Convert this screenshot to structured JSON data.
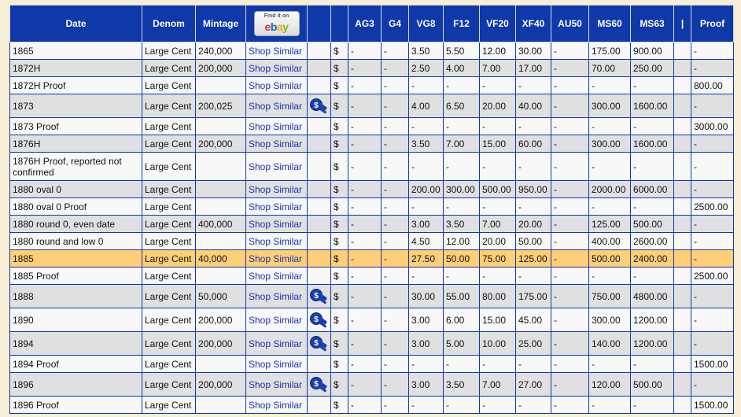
{
  "headers": {
    "date": "Date",
    "denom": "Denom",
    "mintage": "Mintage",
    "ebay_find": "Find it on",
    "ebay_e": "e",
    "ebay_b": "b",
    "ebay_a": "a",
    "ebay_y": "y",
    "ag3": "AG3",
    "g4": "G4",
    "vg8": "VG8",
    "f12": "F12",
    "vf20": "VF20",
    "xf40": "XF40",
    "au50": "AU50",
    "ms60": "MS60",
    "ms63": "MS63",
    "sep": "|",
    "proof": "Proof"
  },
  "colors": {
    "header_bg": "#0f38a9",
    "highlight": "#ffcf78",
    "link": "#1a33b4"
  },
  "rows": [
    {
      "date": "1865",
      "denom": "Large Cent",
      "mintage": "240,000",
      "shop": "Shop Similar",
      "gavel": false,
      "cur": "$",
      "ag3": "-",
      "g4": "-",
      "vg8": "3.50",
      "f12": "5.50",
      "vf20": "12.00",
      "xf40": "30.00",
      "au50": "-",
      "ms60": "175.00",
      "ms63": "900.00",
      "sep": "",
      "proof": "-"
    },
    {
      "date": "1872H",
      "denom": "Large Cent",
      "mintage": "200,000",
      "shop": "Shop Similar",
      "gavel": false,
      "cur": "$",
      "ag3": "-",
      "g4": "-",
      "vg8": "2.50",
      "f12": "4.00",
      "vf20": "7.00",
      "xf40": "17.00",
      "au50": "-",
      "ms60": "70.00",
      "ms63": "250.00",
      "sep": "",
      "proof": "-"
    },
    {
      "date": "1872H Proof",
      "denom": "Large Cent",
      "mintage": "",
      "shop": "Shop Similar",
      "gavel": false,
      "cur": "$",
      "ag3": "-",
      "g4": "-",
      "vg8": "-",
      "f12": "-",
      "vf20": "-",
      "xf40": "-",
      "au50": "-",
      "ms60": "-",
      "ms63": "-",
      "sep": "",
      "proof": "800.00"
    },
    {
      "date": "1873",
      "denom": "Large Cent",
      "mintage": "200,025",
      "shop": "Shop Similar",
      "gavel": true,
      "cur": "$",
      "ag3": "-",
      "g4": "-",
      "vg8": "4.00",
      "f12": "6.50",
      "vf20": "20.00",
      "xf40": "40.00",
      "au50": "-",
      "ms60": "300.00",
      "ms63": "1600.00",
      "sep": "",
      "proof": "-"
    },
    {
      "date": "1873 Proof",
      "denom": "Large Cent",
      "mintage": "",
      "shop": "Shop Similar",
      "gavel": false,
      "cur": "$",
      "ag3": "-",
      "g4": "-",
      "vg8": "-",
      "f12": "-",
      "vf20": "-",
      "xf40": "-",
      "au50": "-",
      "ms60": "-",
      "ms63": "-",
      "sep": "",
      "proof": "3000.00"
    },
    {
      "date": "1876H",
      "denom": "Large Cent",
      "mintage": "200,000",
      "shop": "Shop Similar",
      "gavel": false,
      "cur": "$",
      "ag3": "-",
      "g4": "-",
      "vg8": "3.50",
      "f12": "7.00",
      "vf20": "15.00",
      "xf40": "60.00",
      "au50": "-",
      "ms60": "300.00",
      "ms63": "1600.00",
      "sep": "",
      "proof": "-"
    },
    {
      "date": "1876H Proof, reported not confirmed",
      "denom": "Large Cent",
      "mintage": "",
      "shop": "Shop Similar",
      "gavel": false,
      "cur": "$",
      "ag3": "-",
      "g4": "-",
      "vg8": "-",
      "f12": "-",
      "vf20": "-",
      "xf40": "-",
      "au50": "-",
      "ms60": "-",
      "ms63": "-",
      "sep": "",
      "proof": "-"
    },
    {
      "date": "1880 oval 0",
      "denom": "Large Cent",
      "mintage": "",
      "shop": "Shop Similar",
      "gavel": false,
      "cur": "$",
      "ag3": "-",
      "g4": "-",
      "vg8": "200.00",
      "f12": "300.00",
      "vf20": "500.00",
      "xf40": "950.00",
      "au50": "-",
      "ms60": "2000.00",
      "ms63": "6000.00",
      "sep": "",
      "proof": "-"
    },
    {
      "date": "1880 oval 0 Proof",
      "denom": "Large Cent",
      "mintage": "",
      "shop": "Shop Similar",
      "gavel": false,
      "cur": "$",
      "ag3": "-",
      "g4": "-",
      "vg8": "-",
      "f12": "-",
      "vf20": "-",
      "xf40": "-",
      "au50": "-",
      "ms60": "-",
      "ms63": "-",
      "sep": "",
      "proof": "2500.00"
    },
    {
      "date": "1880 round 0, even date",
      "denom": "Large Cent",
      "mintage": "400,000",
      "shop": "Shop Similar",
      "gavel": false,
      "cur": "$",
      "ag3": "-",
      "g4": "-",
      "vg8": "3.00",
      "f12": "3.50",
      "vf20": "7.00",
      "xf40": "20.00",
      "au50": "-",
      "ms60": "125.00",
      "ms63": "500.00",
      "sep": "",
      "proof": "-"
    },
    {
      "date": "1880 round and low 0",
      "denom": "Large Cent",
      "mintage": "",
      "shop": "Shop Similar",
      "gavel": false,
      "cur": "$",
      "ag3": "-",
      "g4": "-",
      "vg8": "4.50",
      "f12": "12.00",
      "vf20": "20.00",
      "xf40": "50.00",
      "au50": "-",
      "ms60": "400.00",
      "ms63": "2600.00",
      "sep": "",
      "proof": "-"
    },
    {
      "date": "1885",
      "denom": "Large Cent",
      "mintage": "40,000",
      "shop": "Shop Similar",
      "gavel": false,
      "highlight": true,
      "cur": "$",
      "ag3": "-",
      "g4": "-",
      "vg8": "27.50",
      "f12": "50.00",
      "vf20": "75.00",
      "xf40": "125.00",
      "au50": "-",
      "ms60": "500.00",
      "ms63": "2400.00",
      "sep": "",
      "proof": "-"
    },
    {
      "date": "1885 Proof",
      "denom": "Large Cent",
      "mintage": "",
      "shop": "Shop Similar",
      "gavel": false,
      "cur": "$",
      "ag3": "-",
      "g4": "-",
      "vg8": "-",
      "f12": "-",
      "vf20": "-",
      "xf40": "-",
      "au50": "-",
      "ms60": "-",
      "ms63": "-",
      "sep": "",
      "proof": "2500.00"
    },
    {
      "date": "1888",
      "denom": "Large Cent",
      "mintage": "50,000",
      "shop": "Shop Similar",
      "gavel": true,
      "cur": "$",
      "ag3": "-",
      "g4": "-",
      "vg8": "30.00",
      "f12": "55.00",
      "vf20": "80.00",
      "xf40": "175.00",
      "au50": "-",
      "ms60": "750.00",
      "ms63": "4800.00",
      "sep": "",
      "proof": "-"
    },
    {
      "date": "1890",
      "denom": "Large Cent",
      "mintage": "200,000",
      "shop": "Shop Similar",
      "gavel": true,
      "cur": "$",
      "ag3": "-",
      "g4": "-",
      "vg8": "3.00",
      "f12": "6.00",
      "vf20": "15.00",
      "xf40": "45.00",
      "au50": "-",
      "ms60": "300.00",
      "ms63": "1200.00",
      "sep": "",
      "proof": "-"
    },
    {
      "date": "1894",
      "denom": "Large Cent",
      "mintage": "200,000",
      "shop": "Shop Similar",
      "gavel": true,
      "cur": "$",
      "ag3": "-",
      "g4": "-",
      "vg8": "3.00",
      "f12": "5.00",
      "vf20": "10.00",
      "xf40": "25.00",
      "au50": "-",
      "ms60": "140.00",
      "ms63": "1200.00",
      "sep": "",
      "proof": "-"
    },
    {
      "date": "1894 Proof",
      "denom": "Large Cent",
      "mintage": "",
      "shop": "Shop Similar",
      "gavel": false,
      "cur": "$",
      "ag3": "-",
      "g4": "-",
      "vg8": "-",
      "f12": "-",
      "vf20": "-",
      "xf40": "-",
      "au50": "-",
      "ms60": "-",
      "ms63": "-",
      "sep": "",
      "proof": "1500.00"
    },
    {
      "date": "1896",
      "denom": "Large Cent",
      "mintage": "200,000",
      "shop": "Shop Similar",
      "gavel": true,
      "cur": "$",
      "ag3": "-",
      "g4": "-",
      "vg8": "3.00",
      "f12": "3.50",
      "vf20": "7.00",
      "xf40": "27.00",
      "au50": "-",
      "ms60": "120.00",
      "ms63": "500.00",
      "sep": "",
      "proof": "-"
    },
    {
      "date": "1896 Proof",
      "denom": "Large Cent",
      "mintage": "",
      "shop": "Shop Similar",
      "gavel": false,
      "cur": "$",
      "ag3": "-",
      "g4": "-",
      "vg8": "-",
      "f12": "-",
      "vf20": "-",
      "xf40": "-",
      "au50": "-",
      "ms60": "-",
      "ms63": "-",
      "sep": "",
      "proof": "1500.00"
    }
  ]
}
